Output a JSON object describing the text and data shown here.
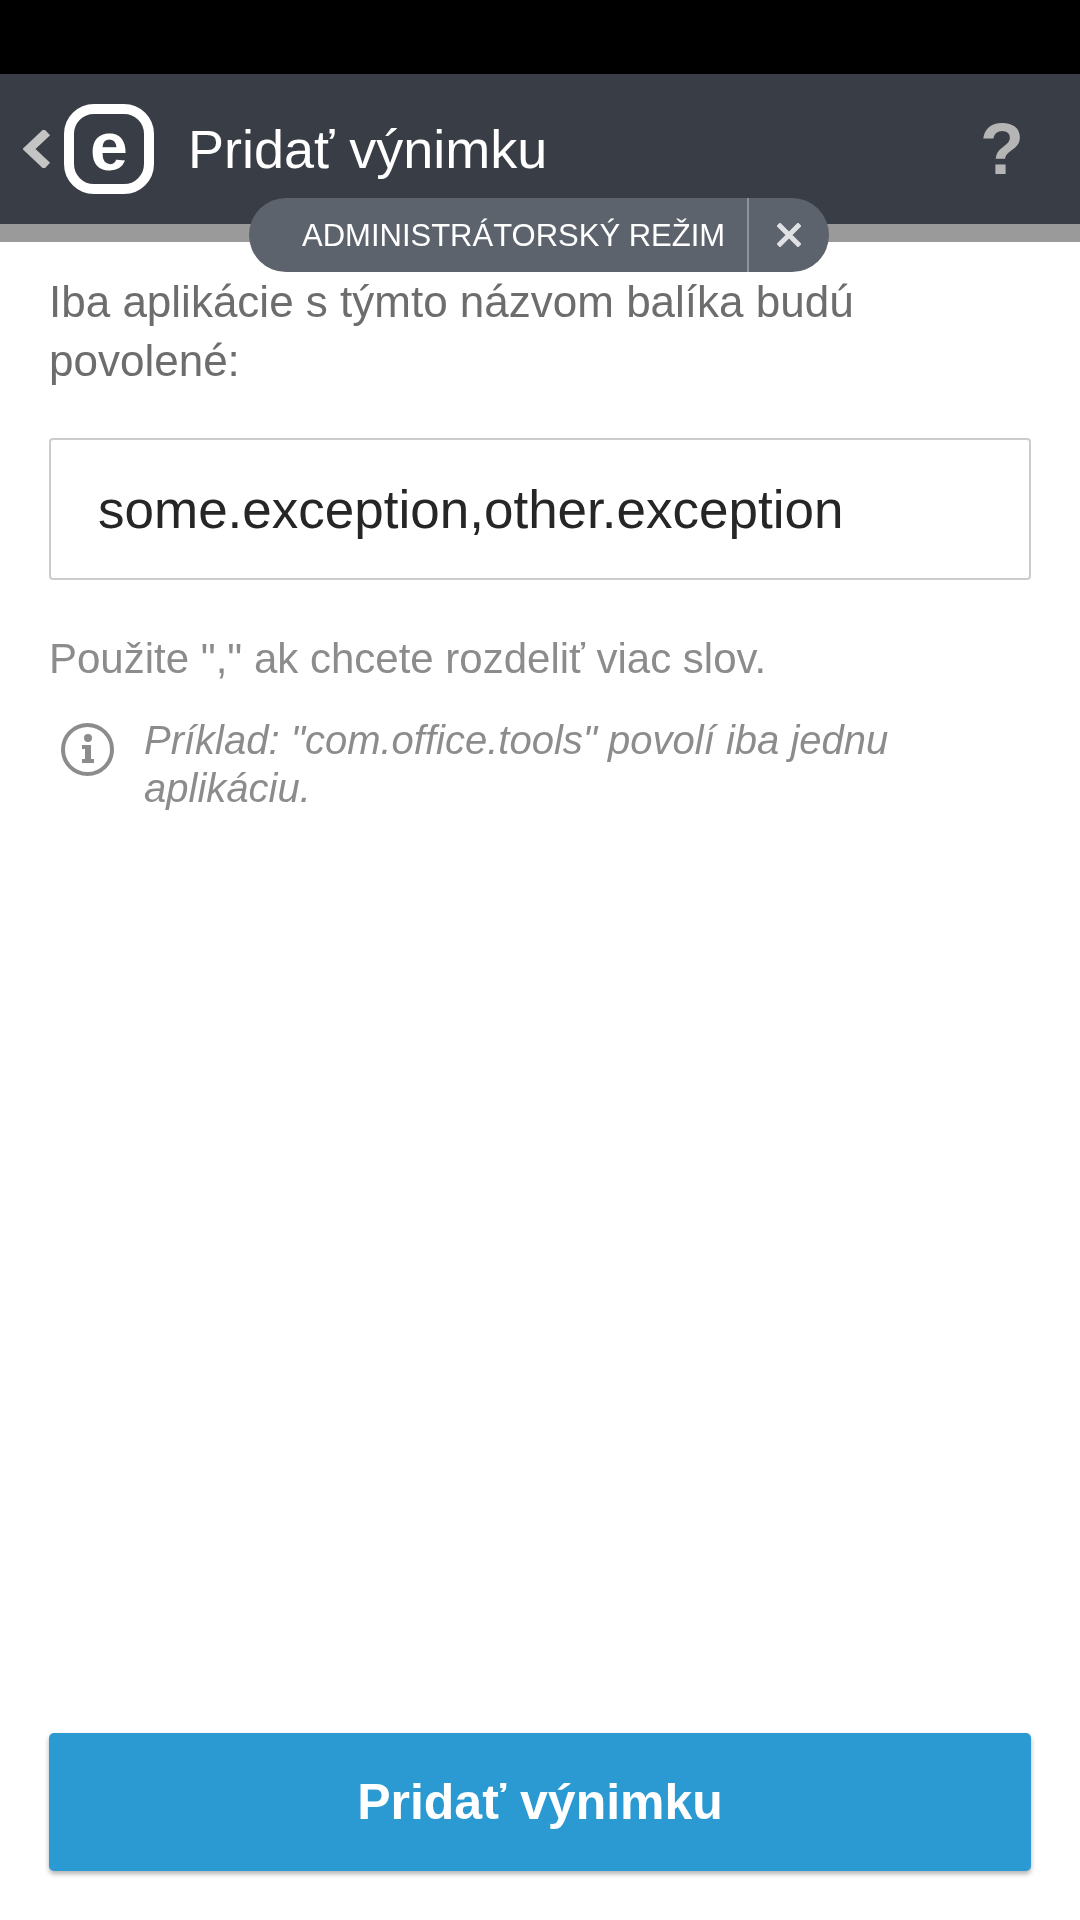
{
  "app_bar": {
    "logo_letter": "e",
    "title": "Pridať výnimku",
    "help_glyph": "?"
  },
  "admin_mode_banner": {
    "label": "ADMINISTRÁTORSKÝ REŽIM"
  },
  "description": "Iba aplikácie s týmto názvom balíka budú povolené:",
  "package_field": {
    "value": "some.exception,other.exception"
  },
  "hint": "Použite \",\" ak chcete rozdeliť viac slov.",
  "example": "Príklad: \"com.office.tools\" povolí iba jednu aplikáciu.",
  "primary_button": {
    "label": "Pridať výnimku"
  }
}
